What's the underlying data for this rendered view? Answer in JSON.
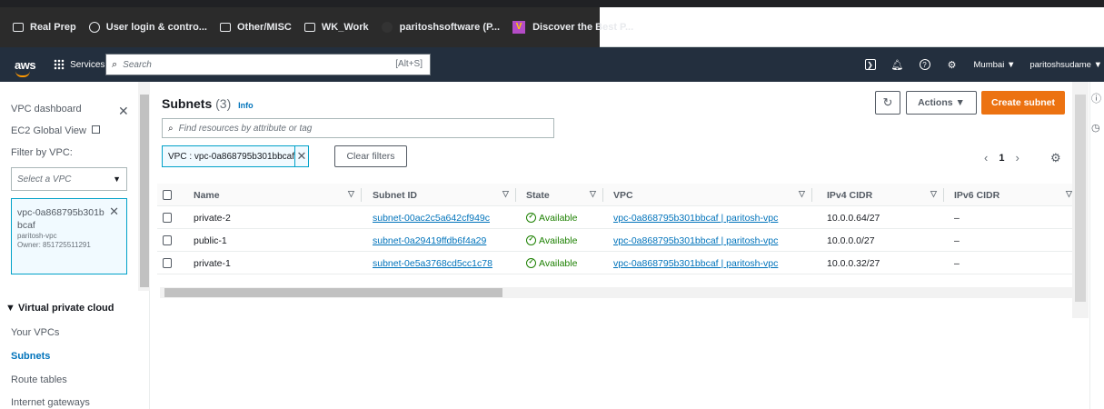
{
  "bookmarks": [
    {
      "label": "Real Prep",
      "icon": "folder-icon"
    },
    {
      "label": "User login & contro...",
      "icon": "globe-icon"
    },
    {
      "label": "Other/MISC",
      "icon": "folder-icon"
    },
    {
      "label": "WK_Work",
      "icon": "folder-icon"
    },
    {
      "label": "paritoshsoftware (P...",
      "icon": "github-icon"
    },
    {
      "label": "Discover the Best P...",
      "icon": "v-logo-icon"
    }
  ],
  "topnav": {
    "logo": "aws",
    "services": "Services",
    "search_placeholder": "Search",
    "search_shortcut": "[Alt+S]",
    "region": "Mumbai ▼",
    "account": "paritoshsudame ▼"
  },
  "sidebar": {
    "vpc_dashboard": "VPC dashboard",
    "ec2_global_view": "EC2 Global View",
    "filter_by_vpc": "Filter by VPC:",
    "select_placeholder": "Select a VPC",
    "selected_vpc": {
      "id": "vpc-0a868795b301bbcaf",
      "name": "paritosh-vpc",
      "owner": "Owner: 851725511291"
    },
    "section": "▼ Virtual private cloud",
    "items": [
      "Your VPCs",
      "Subnets",
      "Route tables",
      "Internet gateways"
    ],
    "active_item": "Subnets"
  },
  "main": {
    "title": "Subnets",
    "count": "(3)",
    "info": "Info",
    "refresh": "C",
    "actions": "Actions ▼",
    "create": "Create subnet",
    "find_placeholder": "Find resources by attribute or tag",
    "token": "VPC : vpc-0a868795b301bbcaf",
    "clear_filters": "Clear filters",
    "page": "1",
    "columns": [
      "Name",
      "Subnet ID",
      "State",
      "VPC",
      "IPv4 CIDR",
      "IPv6 CIDR"
    ],
    "rows": [
      {
        "name": "private-2",
        "subnet_id": "subnet-00ac2c5a642cf949c",
        "state": "Available",
        "vpc": "vpc-0a868795b301bbcaf | paritosh-vpc",
        "ipv4": "10.0.0.64/27",
        "ipv6": "–"
      },
      {
        "name": "public-1",
        "subnet_id": "subnet-0a29419ffdb6f4a29",
        "state": "Available",
        "vpc": "vpc-0a868795b301bbcaf | paritosh-vpc",
        "ipv4": "10.0.0.0/27",
        "ipv6": "–"
      },
      {
        "name": "private-1",
        "subnet_id": "subnet-0e5a3768cd5cc1c78",
        "state": "Available",
        "vpc": "vpc-0a868795b301bbcaf | paritosh-vpc",
        "ipv4": "10.0.0.32/27",
        "ipv6": "–"
      }
    ]
  },
  "colors": {
    "nav_bg": "#232f3e",
    "accent": "#ec7211",
    "link": "#0073bb",
    "success": "#1d8102"
  }
}
